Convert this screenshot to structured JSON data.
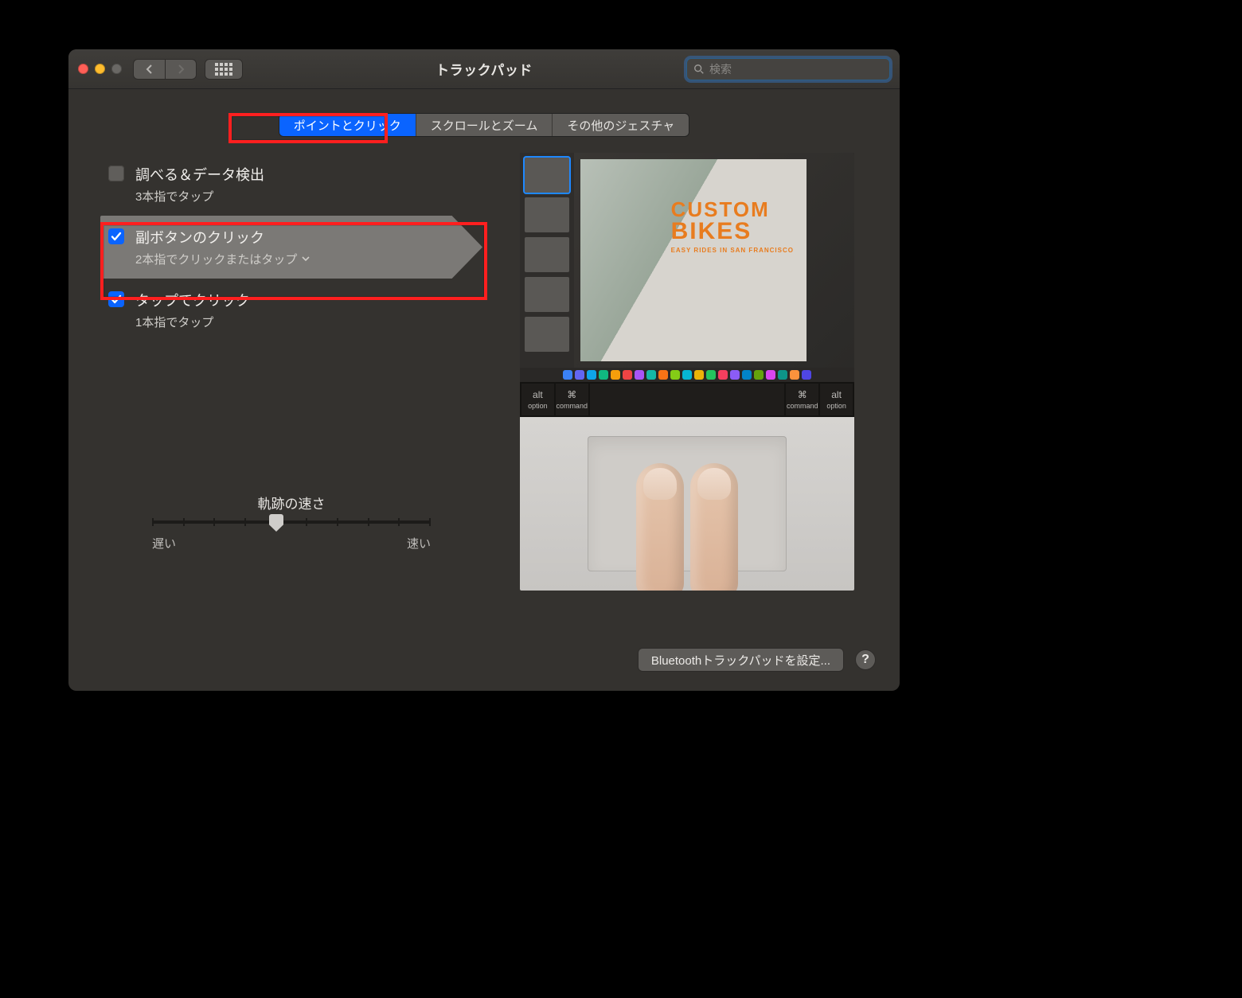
{
  "window": {
    "title": "トラックパッド"
  },
  "search": {
    "placeholder": "検索"
  },
  "tabs": [
    {
      "label": "ポイントとクリック",
      "active": true
    },
    {
      "label": "スクロールとズーム",
      "active": false
    },
    {
      "label": "その他のジェスチャ",
      "active": false
    }
  ],
  "options": [
    {
      "title": "調べる＆データ検出",
      "subtitle": "3本指でタップ",
      "checked": false,
      "selected": false,
      "dropdown": false
    },
    {
      "title": "副ボタンのクリック",
      "subtitle": "2本指でクリックまたはタップ",
      "checked": true,
      "selected": true,
      "dropdown": true
    },
    {
      "title": "タップでクリック",
      "subtitle": "1本指でタップ",
      "checked": true,
      "selected": false,
      "dropdown": false
    }
  ],
  "tracking": {
    "label": "軌跡の速さ",
    "slow": "遅い",
    "fast": "速い"
  },
  "preview": {
    "overlay_line1": "CUSTOM",
    "overlay_line2": "BIKES",
    "overlay_line3": "EASY RIDES IN SAN FRANCISCO",
    "keys": [
      "alt",
      "⌘",
      "",
      "⌘",
      "alt"
    ],
    "key_sub": [
      "option",
      "command",
      "",
      "command",
      "option"
    ]
  },
  "footer": {
    "setup": "Bluetoothトラックパッドを設定...",
    "help": "?"
  },
  "dock_colors": [
    "#3b82f6",
    "#6366f1",
    "#0ea5e9",
    "#10b981",
    "#f59e0b",
    "#ef4444",
    "#a855f7",
    "#14b8a6",
    "#f97316",
    "#84cc16",
    "#06b6d4",
    "#eab308",
    "#22c55e",
    "#f43f5e",
    "#8b5cf6",
    "#0284c7",
    "#65a30d",
    "#d946ef",
    "#0d9488",
    "#fb923c",
    "#4f46e5"
  ]
}
